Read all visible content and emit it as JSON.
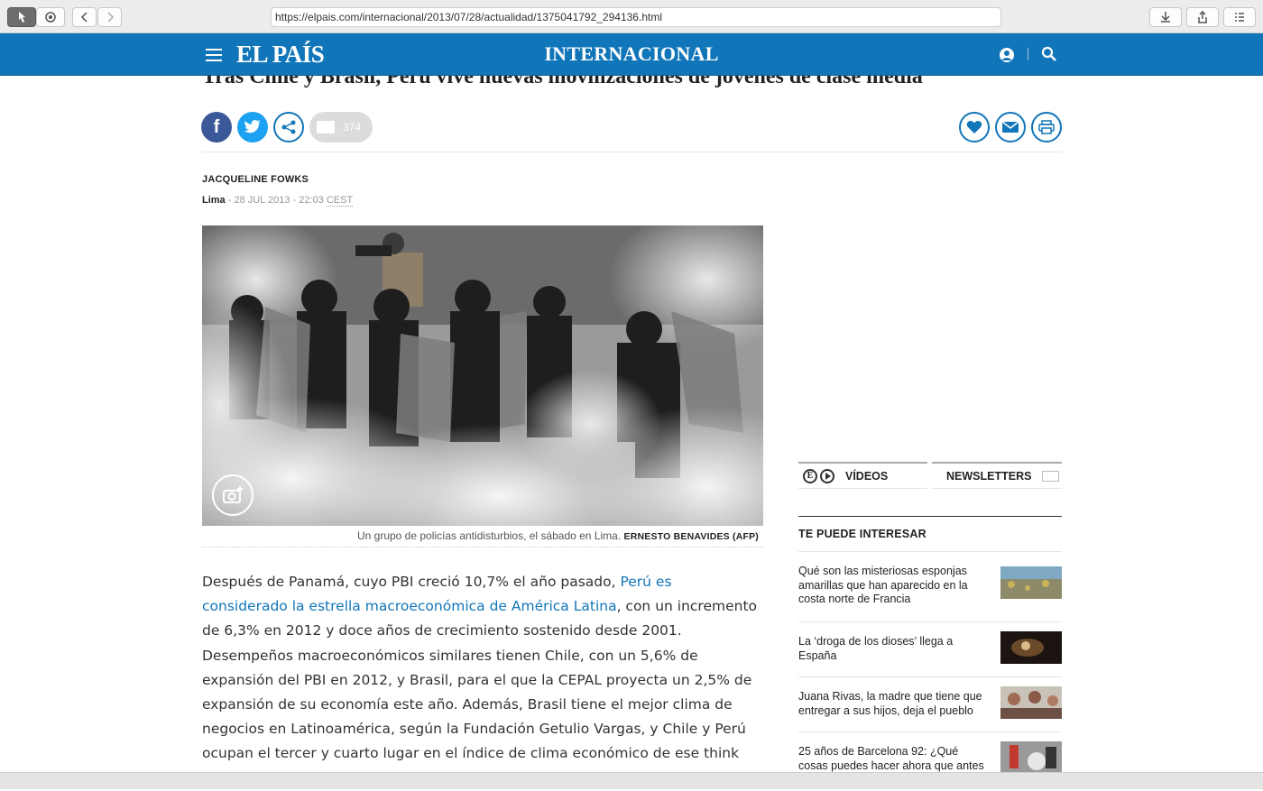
{
  "browser": {
    "url": "https://elpais.com/internacional/2013/07/28/actualidad/1375041792_294136.html"
  },
  "site": {
    "logo": "EL PAÍS",
    "section": "INTERNACIONAL",
    "brand_color": "#1175b9"
  },
  "article": {
    "headline": "Tras Chile y Brasil, Perú vive nuevas movilizaciones de jóvenes de clase media",
    "comment_count": "374",
    "author": "JACQUELINE FOWKS",
    "city": "Lima",
    "date_sep": " - ",
    "date": "28 JUL 2013 - 22:03",
    "timezone": "CEST",
    "caption": "Un grupo de policías antidisturbios, el sábado en Lima.",
    "credit": "ERNESTO BENAVIDES (AFP)",
    "body_part1": "Después de Panamá, cuyo PBI creció 10,7% el año pasado, ",
    "body_link": "Perú es considerado la estrella macroeconómica de América Latina",
    "body_part2": ", con un incremento de 6,3% en 2012 y doce años de crecimiento sostenido desde 2001. Desempeños macroeconómicos similares tienen Chile, con un 5,6% de expansión del PBI en 2012, y Brasil, para el que la CEPAL proyecta un 2,5% de expansión de su economía este año. Además, Brasil tiene el mejor clima de negocios en Latinoamérica, según la Fundación Getulio Vargas, y Chile y Perú ocupan el tercer y cuarto lugar en el índice de clima económico de ese think tank brasileño."
  },
  "sidebar": {
    "tab_videos": "VÍDEOS",
    "tab_newsletters": "NEWSLETTERS",
    "title": "TE PUEDE INTERESAR",
    "items": [
      {
        "text": "Qué son las misteriosas esponjas amarillas que han aparecido en la costa norte de Francia"
      },
      {
        "text": "La ‘droga de los dioses’ llega a España"
      },
      {
        "text": "Juana Rivas, la madre que tiene que entregar a sus hijos, deja el pueblo"
      },
      {
        "text": "25 años de Barcelona 92: ¿Qué cosas puedes hacer ahora que antes no te imaginabas?"
      }
    ]
  },
  "icons": [
    "pointer-icon",
    "screenshot-icon",
    "back-icon",
    "forward-icon",
    "download-icon",
    "share-icon",
    "reader-icon",
    "menu-icon",
    "user-icon",
    "search-icon",
    "facebook-icon",
    "twitter-icon",
    "share-network-icon",
    "comment-icon",
    "heart-icon",
    "mail-icon",
    "print-icon",
    "camera-icon",
    "video-play-icon",
    "newsletter-mail-icon"
  ]
}
